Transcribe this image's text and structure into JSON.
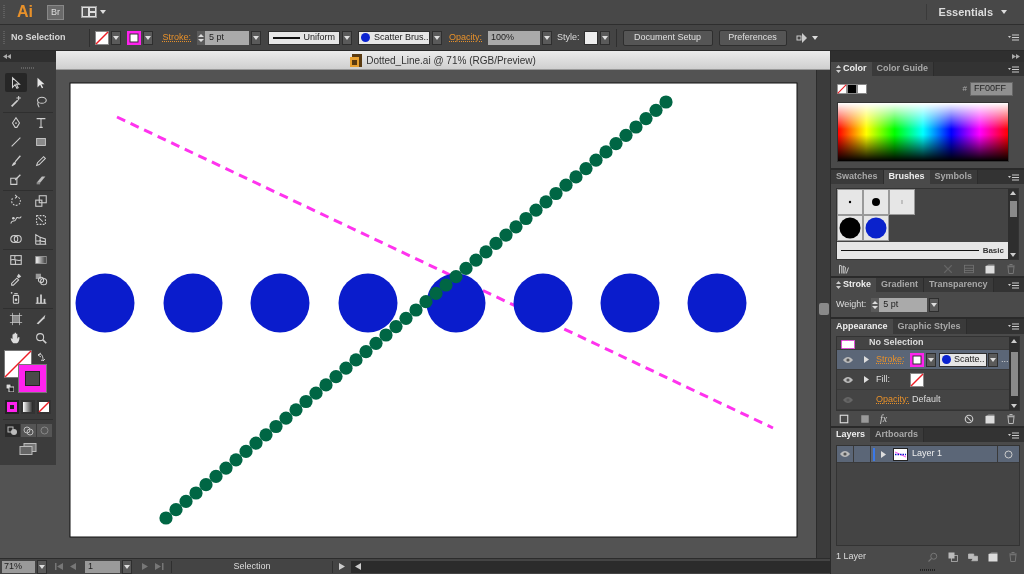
{
  "app_bar": {
    "logo": "Ai",
    "bridge": "Br",
    "workspace": "Essentials"
  },
  "control_bar": {
    "selection": "No Selection",
    "stroke_label": "Stroke:",
    "stroke_weight": "5 pt",
    "profile": "Uniform",
    "brush": "Scatter Brus..",
    "opacity_label": "Opacity:",
    "opacity": "100%",
    "style_label": "Style:",
    "buttons": [
      "Document Setup",
      "Preferences"
    ]
  },
  "tools": [
    {
      "selected": true
    },
    {
      "selected": false
    },
    {
      "selected": false
    },
    {
      "selected": false
    },
    {
      "selected": false
    },
    {
      "selected": false
    },
    {
      "selected": false
    },
    {
      "selected": false
    },
    {
      "selected": false
    },
    {
      "selected": false
    },
    {
      "selected": false
    },
    {
      "selected": false
    },
    {
      "selected": false
    },
    {
      "selected": false
    },
    {
      "selected": false
    },
    {
      "selected": false
    },
    {
      "selected": false
    },
    {
      "selected": false
    },
    {
      "selected": false
    },
    {
      "selected": false
    },
    {
      "selected": false
    },
    {
      "selected": false
    },
    {
      "selected": false
    },
    {
      "selected": false
    },
    {
      "selected": false
    },
    {
      "selected": false
    },
    {
      "selected": false
    },
    {
      "selected": false
    }
  ],
  "document": {
    "title": "Dotted_Line.ai @ 71% (RGB/Preview)"
  },
  "color_panel": {
    "tabs": [
      {
        "label": "Color",
        "selected": true
      },
      {
        "label": "Color Guide",
        "selected": false
      }
    ],
    "hex_label": "#",
    "hex": "FF00FF"
  },
  "brushes_panel": {
    "tabs": [
      {
        "label": "Swatches",
        "selected": false
      },
      {
        "label": "Brushes",
        "selected": true
      },
      {
        "label": "Symbols",
        "selected": false
      }
    ],
    "basic": "Basic"
  },
  "stroke_panel": {
    "tabs": [
      {
        "label": "Stroke",
        "selected": true
      },
      {
        "label": "Gradient",
        "selected": false
      },
      {
        "label": "Transparency",
        "selected": false
      }
    ],
    "weight_label": "Weight:",
    "weight": "5 pt"
  },
  "appearance_panel": {
    "tabs": [
      {
        "label": "Appearance",
        "selected": true
      },
      {
        "label": "Graphic Styles",
        "selected": false
      }
    ],
    "rows": [
      {
        "kind": "header",
        "label": "No Selection",
        "selected": false
      },
      {
        "kind": "stroke",
        "label": "Stroke:",
        "brush": "Scatte..",
        "more": "...",
        "selected": true
      },
      {
        "kind": "fill",
        "label": "Fill:",
        "selected": false
      },
      {
        "kind": "opacity",
        "label": "Opacity:",
        "value": "Default",
        "selected": false
      }
    ],
    "effects_button": "fx"
  },
  "layers_panel": {
    "tabs": [
      {
        "label": "Layers",
        "selected": true
      },
      {
        "label": "Artboards",
        "selected": false
      }
    ],
    "layers": [
      {
        "name": "Layer 1",
        "selected": true
      }
    ],
    "count": "1 Layer"
  },
  "status_bar": {
    "zoom": "71%",
    "artboard": "1",
    "tool": "Selection"
  }
}
